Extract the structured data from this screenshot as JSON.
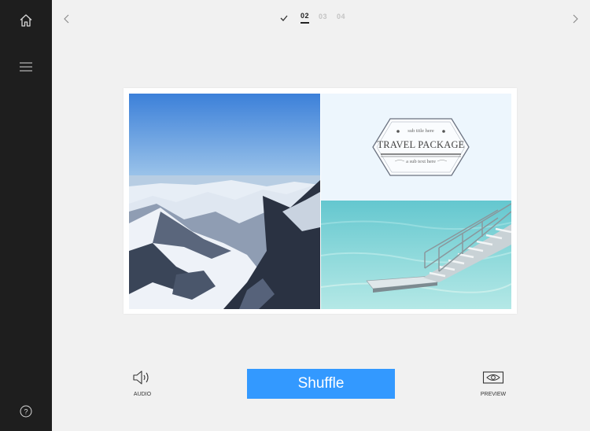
{
  "sidebar": {
    "items": [
      {
        "icon": "home-icon"
      },
      {
        "icon": "menu-icon"
      },
      {
        "icon": "help-icon",
        "label": "?"
      }
    ]
  },
  "topbar": {
    "steps": [
      {
        "label": "",
        "state": "done",
        "icon": "check-icon"
      },
      {
        "label": "02",
        "state": "active"
      },
      {
        "label": "03",
        "state": "inactive"
      },
      {
        "label": "04",
        "state": "inactive"
      }
    ]
  },
  "canvas": {
    "badge": {
      "subtitle": "sub title here",
      "title": "TRAVEL PACKAGE",
      "subtext": "a sub text here"
    }
  },
  "toolbar": {
    "audio_label": "AUDIO",
    "shuffle_label": "Shuffle",
    "preview_label": "PREVIEW"
  },
  "colors": {
    "sidebar": "#1e1e1e",
    "background": "#f1f1f1",
    "accent": "#3399ff"
  }
}
